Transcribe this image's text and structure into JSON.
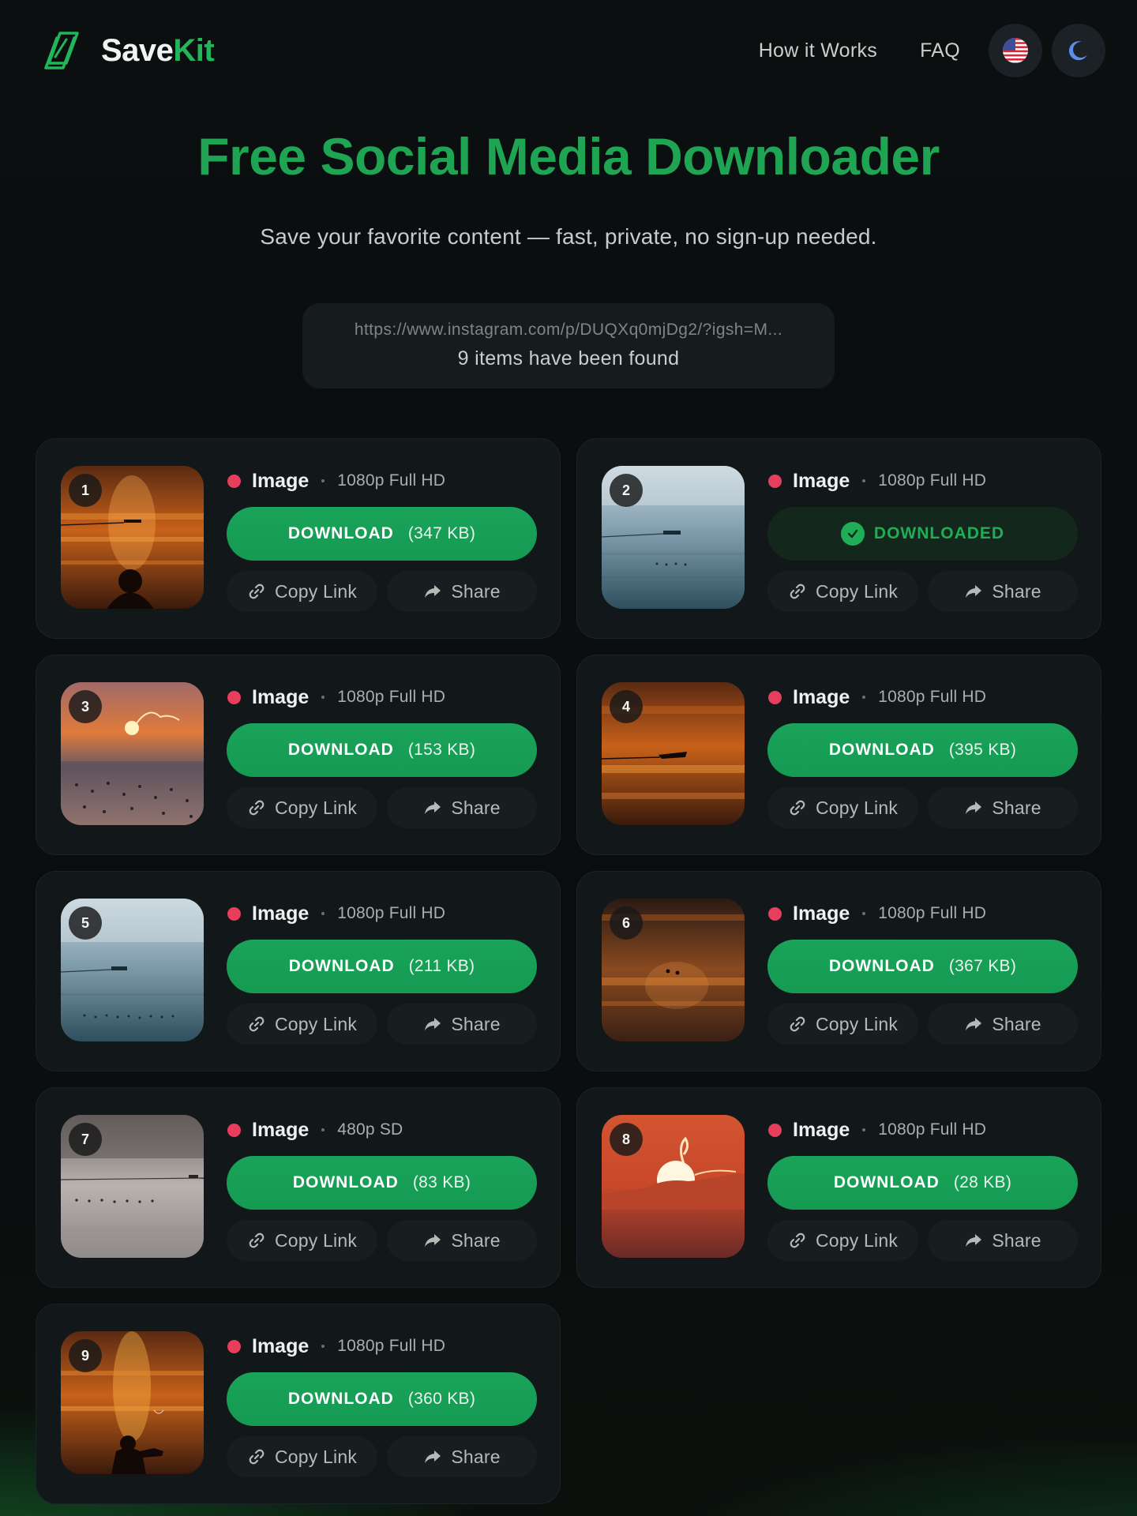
{
  "brand": {
    "name_part1": "Save",
    "name_part2": "Kit",
    "accent": "#22b55a"
  },
  "nav": {
    "links": [
      "How it Works",
      "FAQ"
    ],
    "language_icon": "us-flag-icon",
    "theme_icon": "moon-icon"
  },
  "hero": {
    "title": "Free Social Media Downloader",
    "subtitle": "Save your favorite content — fast, private, no sign-up needed."
  },
  "result": {
    "url": "https://www.instagram.com/p/DUQXq0mjDg2/?igsh=M...",
    "found_text": "9 items have been found"
  },
  "actions": {
    "copy_label": "Copy Link",
    "share_label": "Share",
    "downloaded_label": "DOWNLOADED"
  },
  "items": [
    {
      "index": "1",
      "type": "Image",
      "quality": "1080p Full HD",
      "action": "DOWNLOAD",
      "size": "(347 KB)",
      "downloaded": false
    },
    {
      "index": "2",
      "type": "Image",
      "quality": "1080p Full HD",
      "action": "DOWNLOADED",
      "size": "",
      "downloaded": true
    },
    {
      "index": "3",
      "type": "Image",
      "quality": "1080p Full HD",
      "action": "DOWNLOAD",
      "size": "(153 KB)",
      "downloaded": false
    },
    {
      "index": "4",
      "type": "Image",
      "quality": "1080p Full HD",
      "action": "DOWNLOAD",
      "size": "(395 KB)",
      "downloaded": false
    },
    {
      "index": "5",
      "type": "Image",
      "quality": "1080p Full HD",
      "action": "DOWNLOAD",
      "size": "(211 KB)",
      "downloaded": false
    },
    {
      "index": "6",
      "type": "Image",
      "quality": "1080p Full HD",
      "action": "DOWNLOAD",
      "size": "(367 KB)",
      "downloaded": false
    },
    {
      "index": "7",
      "type": "Image",
      "quality": "480p SD",
      "action": "DOWNLOAD",
      "size": "(83 KB)",
      "downloaded": false
    },
    {
      "index": "8",
      "type": "Image",
      "quality": "1080p Full HD",
      "action": "DOWNLOAD",
      "size": "(28 KB)",
      "downloaded": false
    },
    {
      "index": "9",
      "type": "Image",
      "quality": "1080p Full HD",
      "action": "DOWNLOAD",
      "size": "(360 KB)",
      "downloaded": false
    }
  ]
}
